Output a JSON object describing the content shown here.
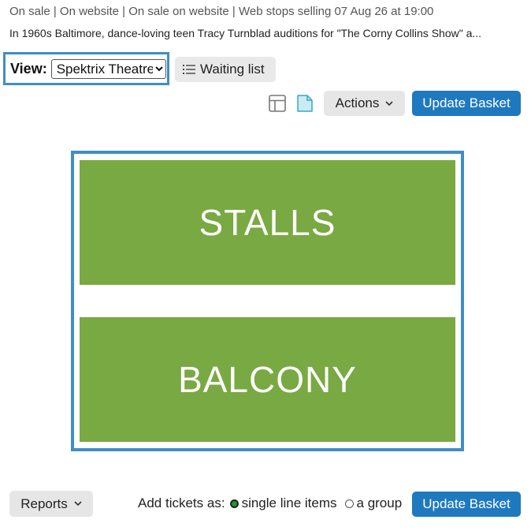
{
  "header": {
    "status_line": "On sale | On website | On sale on website | Web stops selling 07 Aug 26 at 19:00",
    "description": "In 1960s Baltimore, dance-loving teen Tracy Turnblad auditions for \"The Corny Collins Show\" a..."
  },
  "toolbar": {
    "view_label": "View:",
    "view_selected": "Spektrix Theatre",
    "waiting_list_label": "Waiting list",
    "actions_label": "Actions",
    "update_basket_label": "Update Basket"
  },
  "seat_map": {
    "zones": [
      {
        "label": "STALLS",
        "color": "#79a942"
      },
      {
        "label": "BALCONY",
        "color": "#79a942"
      }
    ],
    "frame_color": "#3f8ec7"
  },
  "footer": {
    "reports_label": "Reports",
    "add_tickets_label": "Add tickets as:",
    "option_single": "single line items",
    "option_group": "a group",
    "selected_option": "single line items",
    "update_basket_label": "Update Basket"
  },
  "colors": {
    "primary_button": "#1f79bf",
    "highlight_border": "#3f8ec7",
    "zone_green": "#79a942"
  },
  "icons": [
    "list-icon",
    "grid-view-icon",
    "document-icon",
    "chevron-down-icon"
  ]
}
